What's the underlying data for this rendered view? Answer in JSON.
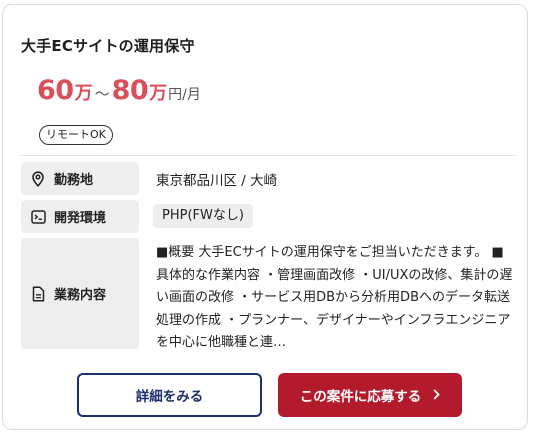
{
  "job": {
    "title": "大手ECサイトの運用保守",
    "salary": {
      "min": "60",
      "max": "80",
      "unit": "万",
      "separator": "～",
      "period": "円/月"
    },
    "badge": "リモートOK"
  },
  "details": {
    "location": {
      "label": "勤務地",
      "value": "東京都品川区 / 大崎"
    },
    "environment": {
      "label": "開発環境",
      "value": "PHP(FWなし)"
    },
    "content": {
      "label": "業務内容",
      "value": "■概要 大手ECサイトの運用保守をご担当いただきます。 ■具体的な作業内容 ・管理画面改修 ・UI/UXの改修、集計の遅い画面の改修 ・サービス用DBから分析用DBへのデータ転送処理の作成 ・プランナー、デザイナーやインフラエンジニアを中心に他職種と連…"
    }
  },
  "actions": {
    "detail_label": "詳細をみる",
    "apply_label": "この案件に応募する",
    "apply_icon": "chevron-right-icon"
  }
}
